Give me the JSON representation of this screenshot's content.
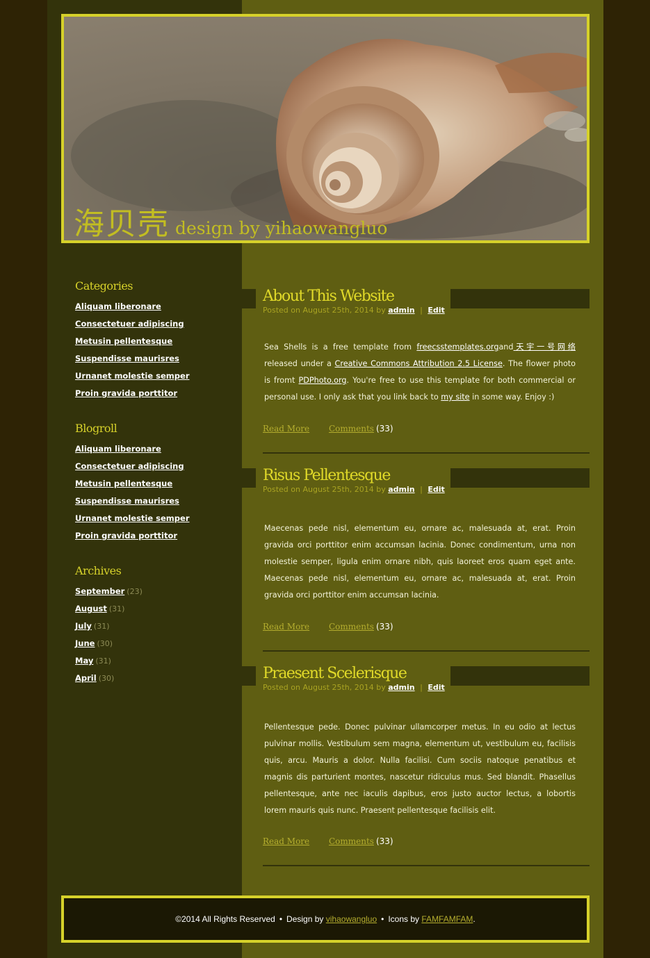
{
  "colors": {
    "page_bg": "#2e2305",
    "content_bg": "#5f5e12",
    "sidebar_bg": "#33330b",
    "accent": "#d6d12a",
    "footer_bg": "#1b1804"
  },
  "header": {
    "title_chinese": "海贝壳",
    "title_english": "design by yihaowangluo",
    "image": "sea-shell-photo"
  },
  "sidebar": {
    "categories": {
      "heading": "Categories",
      "items": [
        "Aliquam liberonare",
        "Consectetuer adipiscing",
        "Metusin pellentesque",
        "Suspendisse maurisres",
        "Urnanet molestie semper",
        "Proin gravida porttitor"
      ]
    },
    "blogroll": {
      "heading": "Blogroll",
      "items": [
        "Aliquam liberonare",
        "Consectetuer adipiscing",
        "Metusin pellentesque",
        "Suspendisse maurisres",
        "Urnanet molestie semper",
        "Proin gravida porttitor"
      ]
    },
    "archives": {
      "heading": "Archives",
      "items": [
        {
          "month": "September",
          "count": "(23)"
        },
        {
          "month": "August",
          "count": "(31)"
        },
        {
          "month": "July",
          "count": "(31)"
        },
        {
          "month": "June",
          "count": "(30)"
        },
        {
          "month": "May",
          "count": "(31)"
        },
        {
          "month": "April",
          "count": "(30)"
        }
      ]
    }
  },
  "posts": [
    {
      "title": "About This Website",
      "meta_prefix": "Posted on August 25th, 2014 by",
      "author": "admin",
      "separator": "|",
      "edit": "Edit",
      "body": {
        "t1": "Sea Shells is a free template from ",
        "link1": "freecsstemplates.org",
        "t2": "and",
        "link2": "天宇一号网络",
        "t3": " released under a ",
        "link3": "Creative Commons Attribution 2.5 License",
        "t4": ". The flower photo is fromt ",
        "link4": "PDPhoto.org",
        "t5": ". You're free to use this template for both commercial or personal use. I only ask that you link back to ",
        "link5": "my site",
        "t6": " in some way. Enjoy :)"
      },
      "read_more": "Read More",
      "comments": "Comments",
      "comment_count": "(33)"
    },
    {
      "title": "Risus Pellentesque",
      "meta_prefix": "Posted on August 25th, 2014 by",
      "author": "admin",
      "separator": "|",
      "edit": "Edit",
      "body": "Maecenas pede nisl, elementum eu, ornare ac, malesuada at, erat. Proin gravida orci porttitor enim accumsan lacinia. Donec condimentum, urna non molestie semper, ligula enim ornare nibh, quis laoreet eros quam eget ante. Maecenas pede nisl, elementum eu, ornare ac, malesuada at, erat. Proin gravida orci porttitor enim accumsan lacinia.",
      "read_more": "Read More",
      "comments": "Comments",
      "comment_count": "(33)"
    },
    {
      "title": "Praesent Scelerisque",
      "meta_prefix": "Posted on August 25th, 2014 by",
      "author": "admin",
      "separator": "|",
      "edit": "Edit",
      "body": "Pellentesque pede. Donec pulvinar ullamcorper metus. In eu odio at lectus pulvinar mollis. Vestibulum sem magna, elementum ut, vestibulum eu, facilisis quis, arcu. Mauris a dolor. Nulla facilisi. Cum sociis natoque penatibus et magnis dis parturient montes, nascetur ridiculus mus. Sed blandit. Phasellus pellentesque, ante nec iaculis dapibus, eros justo auctor lectus, a lobortis lorem mauris quis nunc. Praesent pellentesque facilisis elit.",
      "read_more": "Read More",
      "comments": "Comments",
      "comment_count": "(33)"
    }
  ],
  "footer": {
    "copyright": "©2014 All Rights Reserved",
    "bullet": "•",
    "design_prefix": "Design by",
    "design_link": "vihaowangluo",
    "icons_prefix": "Icons by",
    "icons_link": "FAMFAMFAM",
    "end": "."
  }
}
